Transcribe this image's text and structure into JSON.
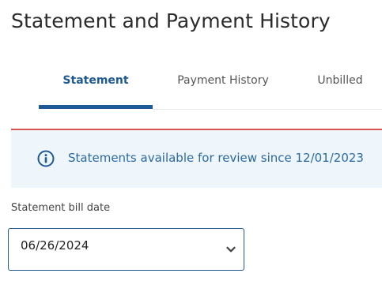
{
  "page": {
    "title": "Statement and Payment History"
  },
  "tabs": [
    {
      "label": "Statement",
      "active": true
    },
    {
      "label": "Payment History",
      "active": false
    },
    {
      "label": "Unbilled",
      "active": false
    }
  ],
  "info_banner": {
    "icon": "info-circle-icon",
    "text": "Statements available for review since 12/01/2023"
  },
  "bill_date": {
    "label": "Statement bill date",
    "selected": "06/26/2024",
    "icon": "chevron-down-icon"
  },
  "colors": {
    "accent": "#1e5a96",
    "alert_rule": "#d9534f",
    "banner_bg": "#eef5fb",
    "banner_text": "#2a6aa3"
  }
}
